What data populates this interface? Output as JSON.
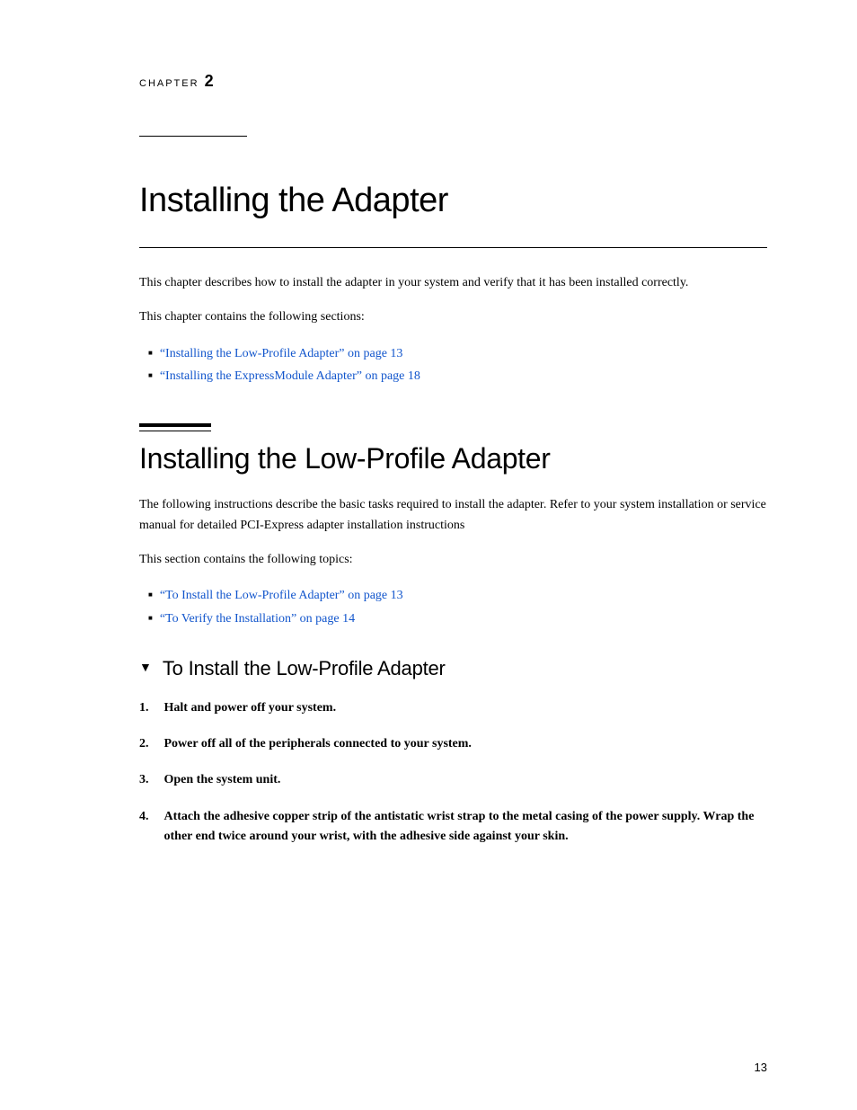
{
  "chapter": {
    "label": "CHAPTER",
    "number": "2"
  },
  "main_title": "Installing the Adapter",
  "intro_paragraph1": "This chapter describes how to install the adapter in your system and verify that it has been installed correctly.",
  "intro_paragraph2": "This chapter contains the following sections:",
  "intro_links": [
    {
      "text": "“Installing the Low-Profile Adapter” on page 13",
      "href": "#low-profile"
    },
    {
      "text": "“Installing the ExpressModule Adapter” on page 18",
      "href": "#expressmodule"
    }
  ],
  "section1": {
    "title": "Installing the Low-Profile Adapter",
    "intro": "The following instructions describe the basic tasks required to install the adapter. Refer to your system installation or service manual for detailed PCI-Express adapter installation instructions",
    "topics_label": "This section contains the following topics:",
    "links": [
      {
        "text": "“To Install the Low-Profile Adapter” on page 13",
        "href": "#install-low-profile"
      },
      {
        "text": "“To Verify the Installation” on page 14",
        "href": "#verify-installation"
      }
    ]
  },
  "subsection1": {
    "title": "To Install the Low-Profile Adapter",
    "triangle": "▼",
    "steps": [
      {
        "number": "1.",
        "text": "Halt and power off your system."
      },
      {
        "number": "2.",
        "text": "Power off all of the peripherals connected to your system."
      },
      {
        "number": "3.",
        "text": "Open the system unit."
      },
      {
        "number": "4.",
        "text": "Attach the adhesive copper strip of the antistatic wrist strap to the metal casing of the power supply. Wrap the other end twice around your wrist, with the adhesive side against your skin."
      }
    ]
  },
  "page_number": "13"
}
